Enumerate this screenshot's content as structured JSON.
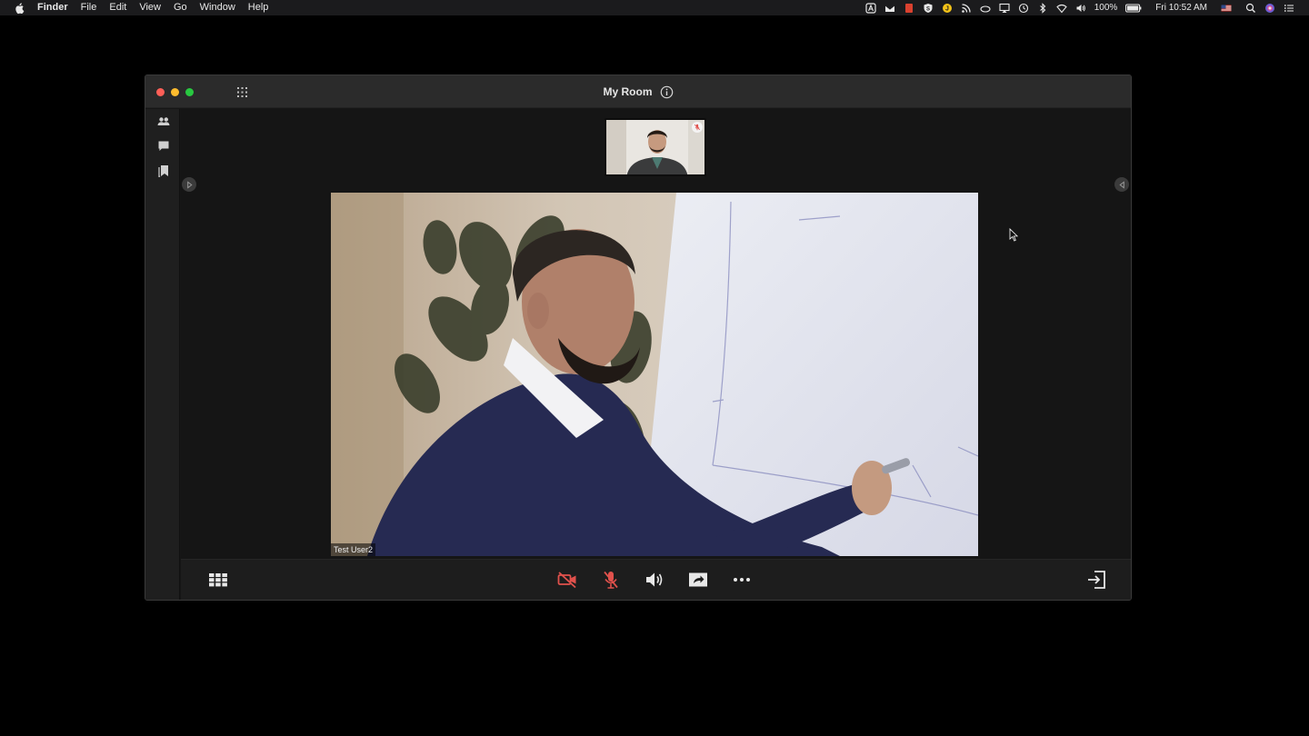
{
  "menubar": {
    "items": [
      "Finder",
      "File",
      "Edit",
      "View",
      "Go",
      "Window",
      "Help"
    ],
    "battery": "100%",
    "clock": "Fri 10:52 AM"
  },
  "window": {
    "title": "My Room"
  },
  "video": {
    "participant_name": "Test User2"
  },
  "colors": {
    "muted_red": "#e0514c",
    "titlebar": "#2b2b2b",
    "toolbar": "#1d1d1d"
  },
  "icons": {
    "rail": [
      "participants-icon",
      "chat-icon",
      "bookmarks-icon"
    ],
    "toolbar": [
      "grid-view-icon",
      "camera-off-icon",
      "mic-off-icon",
      "speaker-icon",
      "share-screen-icon",
      "more-icon",
      "leave-icon"
    ]
  }
}
